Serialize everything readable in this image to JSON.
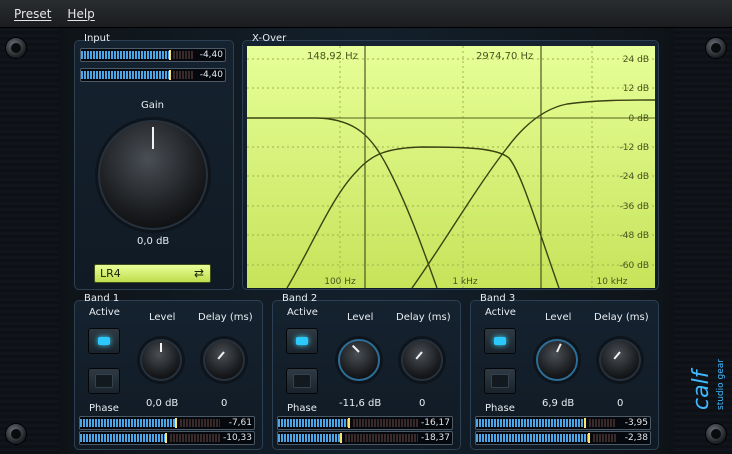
{
  "menu": {
    "items": [
      "Preset",
      "Help"
    ]
  },
  "input": {
    "title": "Input",
    "meters": [
      {
        "value": "-4,40",
        "level": 0.68
      },
      {
        "value": "-4,40",
        "level": 0.68
      }
    ],
    "gain_label": "Gain",
    "gain_value": "0,0 dB",
    "filter_type": "LR4"
  },
  "xover": {
    "title": "X-Over",
    "freq1": "148,92 Hz",
    "freq2": "2974,70 Hz",
    "db_labels": [
      "24 dB",
      "12 dB",
      "0 dB",
      "-12 dB",
      "-24 dB",
      "-36 dB",
      "-48 dB",
      "-60 dB"
    ],
    "freq_labels": [
      "100 Hz",
      "1 kHz",
      "10 kHz"
    ]
  },
  "bands": [
    {
      "title": "Band 1",
      "active_label": "Active",
      "level_label": "Level",
      "delay_label": "Delay (ms)",
      "phase_label": "Phase",
      "level": "0,0 dB",
      "delay": "0",
      "meter1": "-7,61",
      "meter2": "-10,33"
    },
    {
      "title": "Band 2",
      "active_label": "Active",
      "level_label": "Level",
      "delay_label": "Delay (ms)",
      "phase_label": "Phase",
      "level": "-11,6 dB",
      "delay": "0",
      "meter1": "-16,17",
      "meter2": "-18,37"
    },
    {
      "title": "Band 3",
      "active_label": "Active",
      "level_label": "Level",
      "delay_label": "Delay (ms)",
      "phase_label": "Phase",
      "level": "6,9 dB",
      "delay": "0",
      "meter1": "-3,95",
      "meter2": "-2,38"
    }
  ],
  "colors": {
    "accent": "#2cc9ff",
    "graph_bg": "#d9f27c",
    "graph_curve": "#3a4212"
  }
}
